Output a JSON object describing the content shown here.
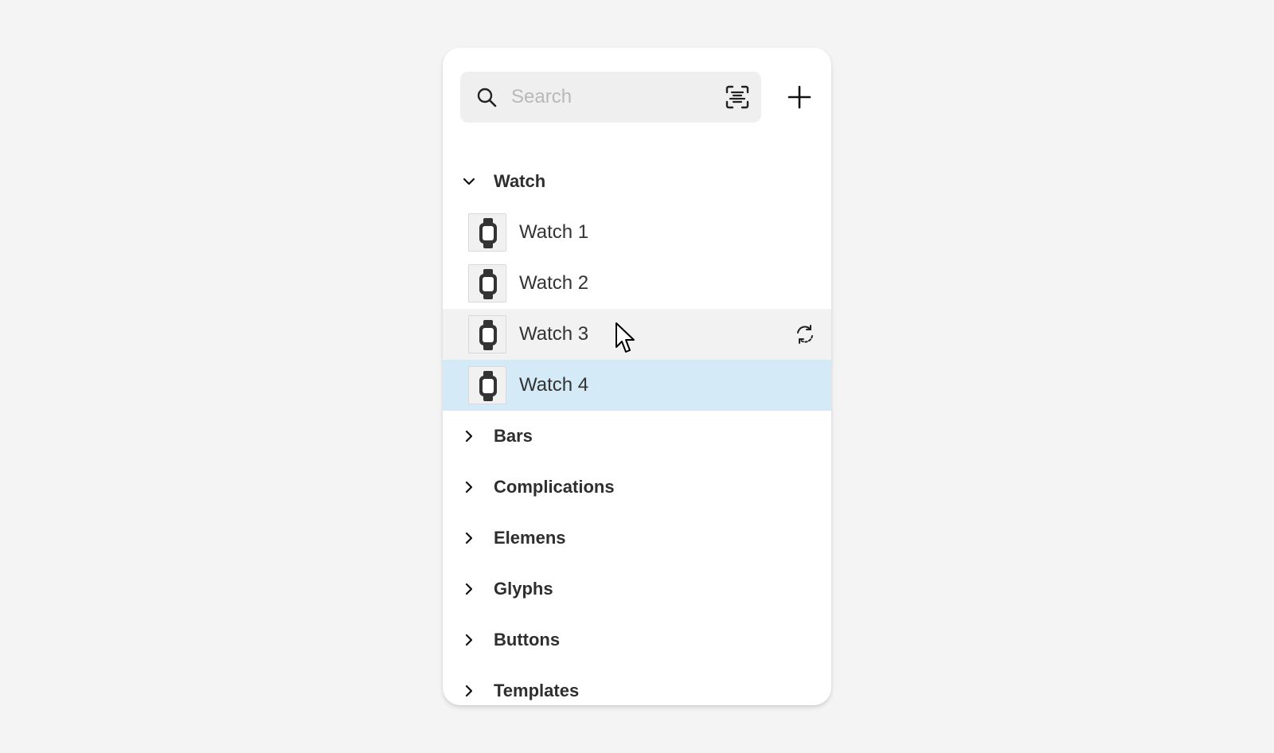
{
  "search": {
    "placeholder": "Search",
    "value": ""
  },
  "groups": [
    {
      "label": "Watch",
      "expanded": true,
      "items": [
        {
          "label": "Watch 1",
          "state": "normal"
        },
        {
          "label": "Watch 2",
          "state": "normal"
        },
        {
          "label": "Watch 3",
          "state": "hover"
        },
        {
          "label": "Watch 4",
          "state": "selected"
        }
      ]
    },
    {
      "label": "Bars",
      "expanded": false
    },
    {
      "label": "Complications",
      "expanded": false
    },
    {
      "label": "Elemens",
      "expanded": false
    },
    {
      "label": "Glyphs",
      "expanded": false
    },
    {
      "label": "Buttons",
      "expanded": false
    },
    {
      "label": "Templates",
      "expanded": false
    }
  ],
  "colors": {
    "background": "#f4f4f4",
    "panel": "#ffffff",
    "search_bg": "#efefef",
    "hover_row": "#f2f2f2",
    "selected_row": "#d4eaf6",
    "text": "#333333"
  },
  "icons": {
    "search": "search-icon",
    "scan": "scan-text-icon",
    "add": "plus-icon",
    "expanded": "chevron-down-icon",
    "collapsed": "chevron-right-icon",
    "thumbnail": "watch-icon",
    "sync": "sync-icon"
  }
}
